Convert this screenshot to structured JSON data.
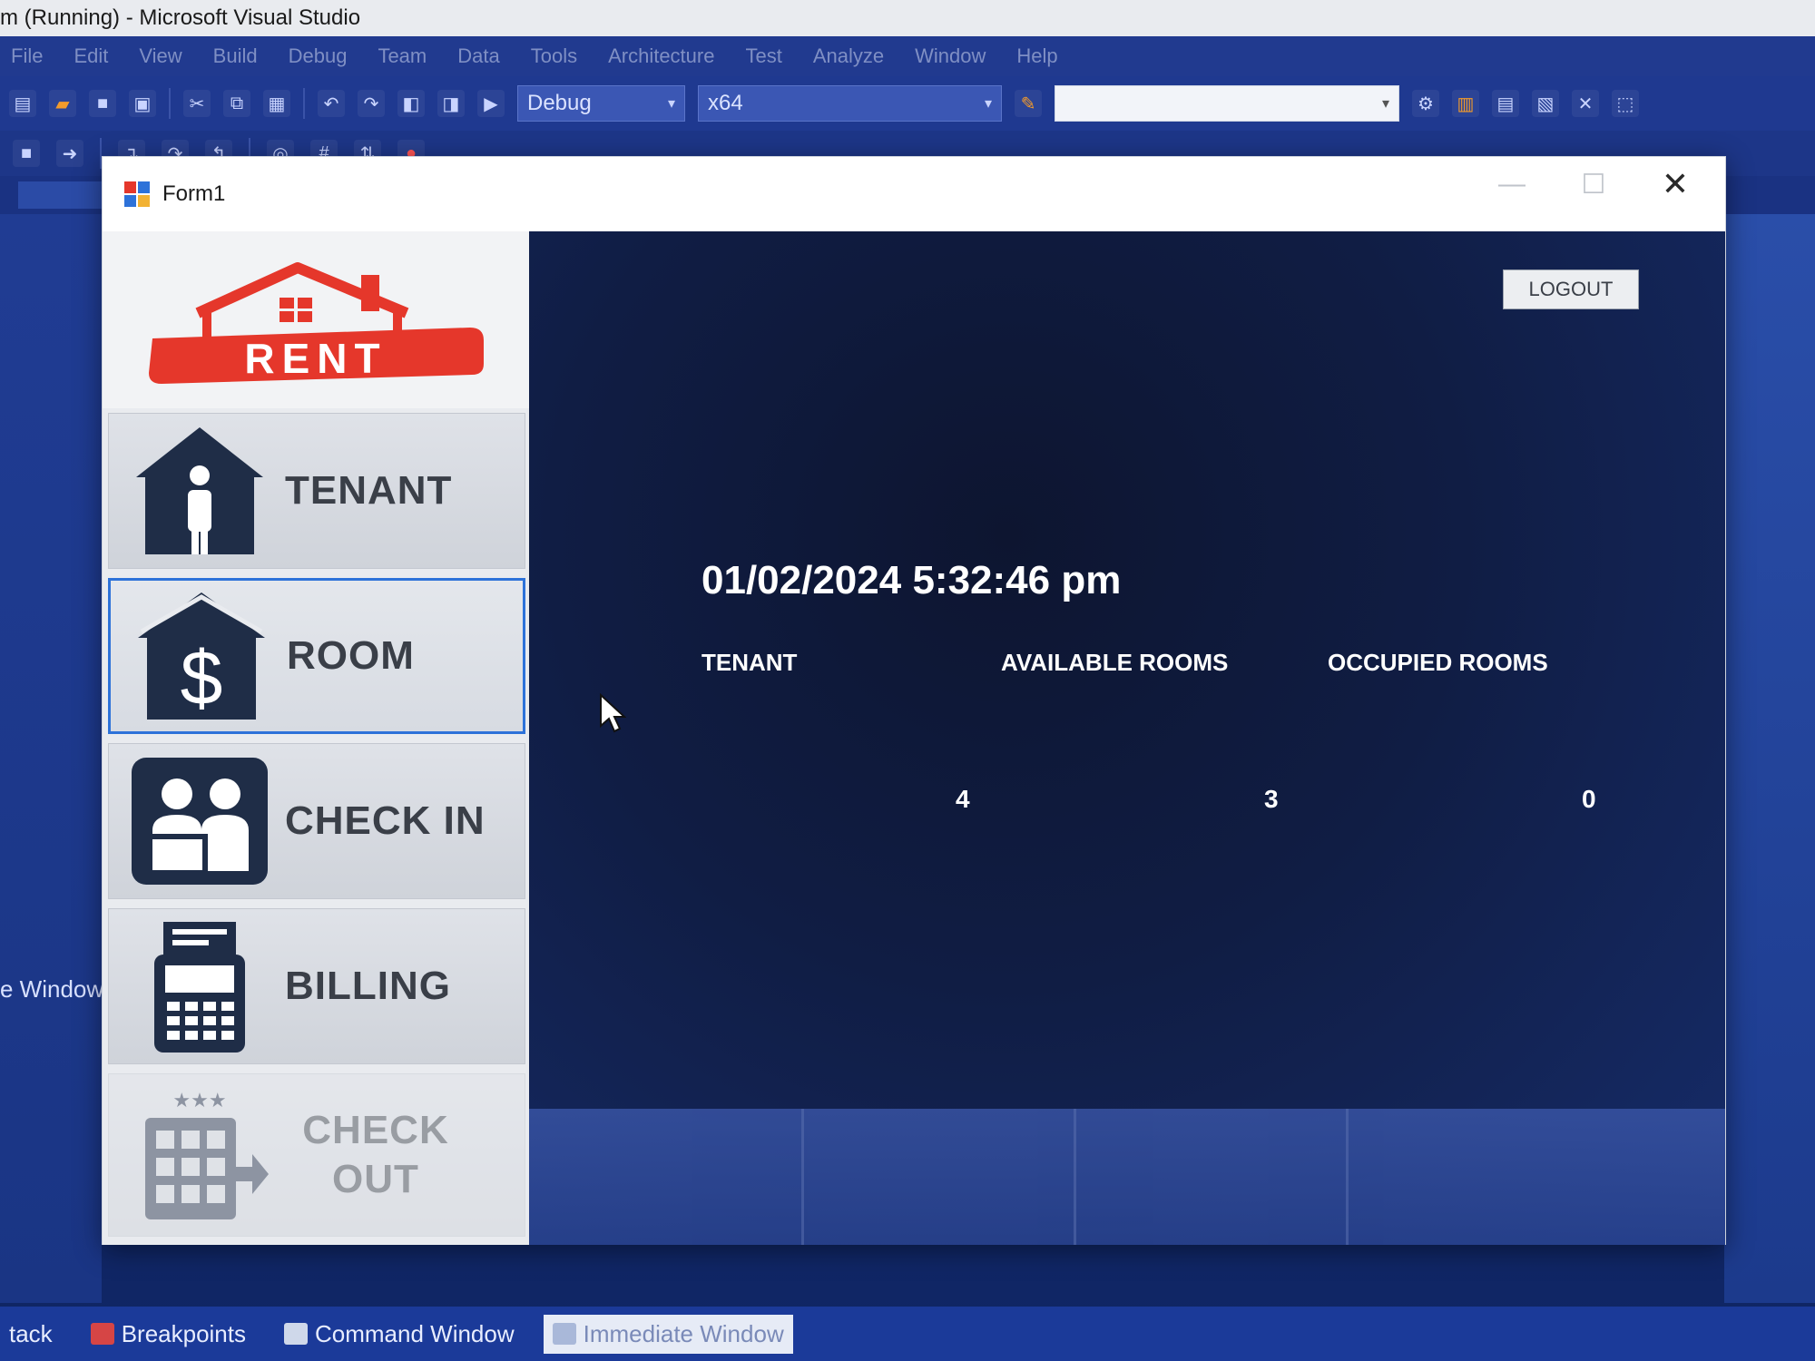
{
  "vs": {
    "title": "m (Running) - Microsoft Visual Studio",
    "menu": [
      "File",
      "Edit",
      "View",
      "Build",
      "Debug",
      "Team",
      "Data",
      "Tools",
      "Architecture",
      "Test",
      "Analyze",
      "Window",
      "Help"
    ],
    "config_value": "Debug",
    "platform_value": "x64",
    "startup_value": "",
    "left_window_label": "e Window",
    "bottom_tabs": [
      "tack",
      "Breakpoints",
      "Command Window",
      "Immediate Window"
    ]
  },
  "form": {
    "title": "Form1",
    "logo_text": "RENT",
    "nav": {
      "tenant": "TENANT",
      "room": "ROOM",
      "checkin": "CHECK IN",
      "billing": "BILLING",
      "checkout_line1": "CHECK",
      "checkout_line2": "OUT"
    },
    "logout_label": "LOGOUT",
    "datetime": "01/02/2024 5:32:46 pm",
    "stats": {
      "tenant_label": "TENANT",
      "available_label": "AVAILABLE ROOMS",
      "occupied_label": "OCCUPIED ROOMS",
      "tenant_value": "4",
      "available_value": "3",
      "occupied_value": "0"
    }
  },
  "colors": {
    "logo_red": "#e5372b",
    "icon_navy": "#1f2d47",
    "selection_blue": "#2d72d9"
  }
}
